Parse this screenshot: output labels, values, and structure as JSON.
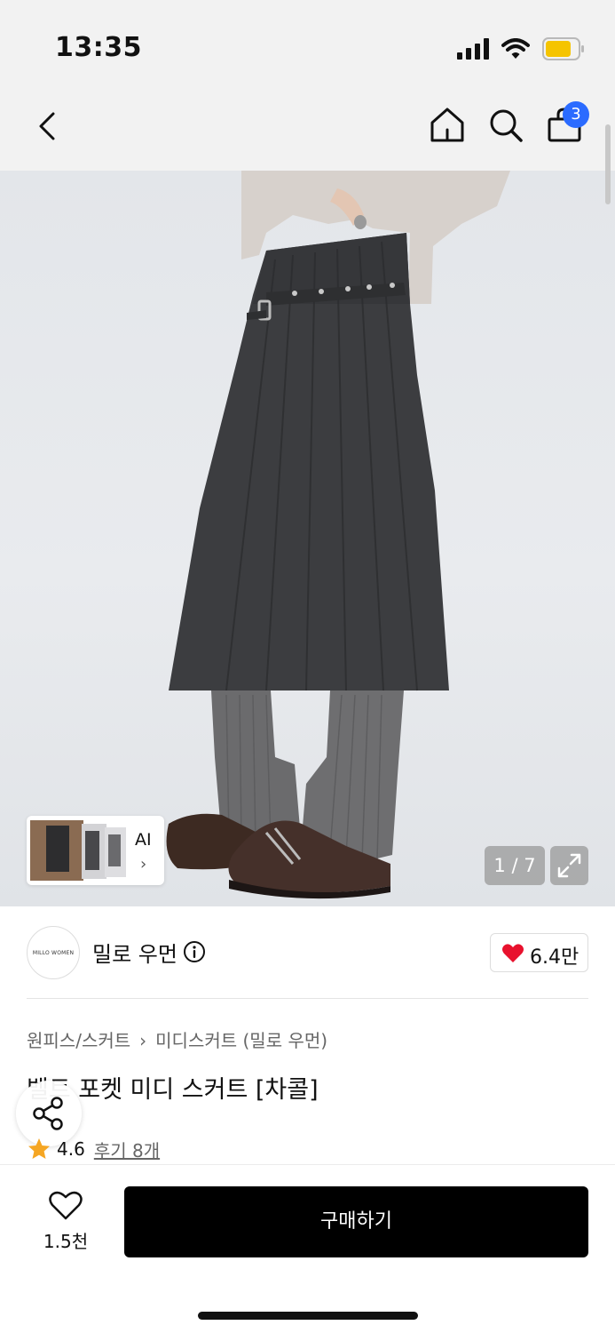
{
  "status_bar": {
    "time": "13:35",
    "icons": [
      "signal-icon",
      "wifi-icon",
      "battery-icon"
    ],
    "battery_color": "#f5c400"
  },
  "nav": {
    "icons": [
      "back-icon",
      "home-icon",
      "search-icon",
      "cart-icon"
    ],
    "cart_badge": "3",
    "badge_color": "#2b6bff"
  },
  "gallery": {
    "ai_label": "AI",
    "ai_chevron": "›",
    "page_counter": "1 / 7",
    "expand_icon": "expand-icon"
  },
  "brand": {
    "logo_text": "MILLO WOMEN",
    "name": "밀로 우먼",
    "like_count": "6.4만",
    "heart_color": "#e8112d"
  },
  "product": {
    "breadcrumb": [
      "원피스/스커트",
      "미디스커트 (밀로 우먼)"
    ],
    "breadcrumb_separator": "›",
    "title": "벨트 포켓 미디 스커트 [차콜]",
    "rating": "4.6",
    "review_link": "후기 8개",
    "star_color": "#f5a623"
  },
  "bottom_bar": {
    "wish_count": "1.5천",
    "buy_label": "구매하기"
  }
}
